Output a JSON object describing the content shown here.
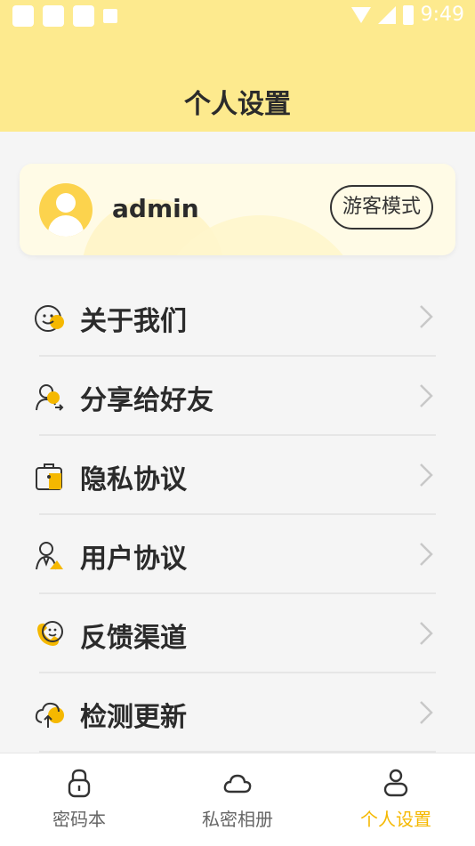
{
  "status_bar": {
    "time": "9:49"
  },
  "header": {
    "title": "个人设置"
  },
  "profile": {
    "username": "admin",
    "guest_button": "游客模式"
  },
  "menu": [
    {
      "label": "关于我们",
      "icon": "smile-chat-icon"
    },
    {
      "label": "分享给好友",
      "icon": "share-user-icon"
    },
    {
      "label": "隐私协议",
      "icon": "privacy-folder-icon"
    },
    {
      "label": "用户协议",
      "icon": "user-agreement-icon"
    },
    {
      "label": "反馈渠道",
      "icon": "feedback-icon"
    },
    {
      "label": "检测更新",
      "icon": "cloud-update-icon"
    }
  ],
  "tabbar": [
    {
      "label": "密码本",
      "icon": "lock-icon"
    },
    {
      "label": "私密相册",
      "icon": "cloud-icon"
    },
    {
      "label": "个人设置",
      "icon": "person-icon",
      "active": true
    }
  ],
  "colors": {
    "accent": "#f5b800",
    "header_bg": "#fdea8e",
    "page_bg": "#f5f5f5"
  }
}
